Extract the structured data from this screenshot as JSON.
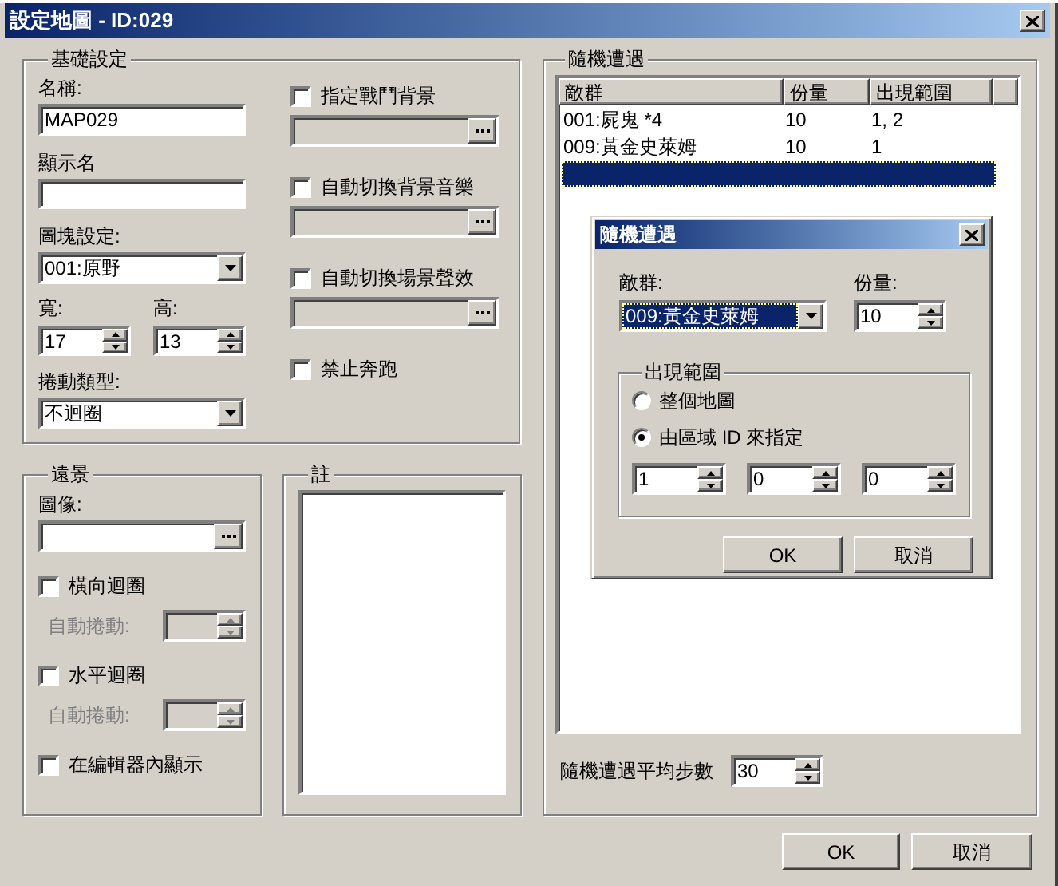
{
  "window": {
    "title": "設定地圖 - ID:029"
  },
  "basic_settings": {
    "title": "基礎設定",
    "name": {
      "label": "名稱:",
      "value": "MAP029"
    },
    "display_name": {
      "label": "顯示名"
    },
    "tileset": {
      "label": "圖塊設定:",
      "value": "001:原野"
    },
    "width": {
      "label": "寬:",
      "value": "17"
    },
    "height": {
      "label": "高:",
      "value": "13"
    },
    "scroll_type": {
      "label": "捲動類型:",
      "value": "不迴圈"
    },
    "options": [
      {
        "kind": "browse",
        "label": "指定戰鬥背景",
        "checked": false
      },
      {
        "kind": "browse",
        "label": "自動切換背景音樂",
        "checked": false
      },
      {
        "kind": "browse",
        "label": "自動切換場景聲效",
        "checked": false
      },
      {
        "kind": "check",
        "label": "禁止奔跑",
        "checked": false
      }
    ]
  },
  "parallax": {
    "title": "遠景",
    "image": {
      "label": "圖像:"
    },
    "items": [
      {
        "kind": "check",
        "label": "橫向迴圈",
        "checked": false
      },
      {
        "kind": "spin",
        "label": "自動捲動:",
        "disabled": true
      },
      {
        "kind": "check",
        "label": "水平迴圈",
        "checked": false
      },
      {
        "kind": "spin",
        "label": "自動捲動:",
        "disabled": true
      },
      {
        "kind": "check",
        "label": "在編輯器內顯示",
        "checked": false
      }
    ]
  },
  "note": {
    "title": "註"
  },
  "encounters": {
    "title": "隨機遭遇",
    "columns": [
      "敵群",
      "份量",
      "出現範圍"
    ],
    "rows": [
      {
        "cells": [
          "001:屍鬼 *4",
          "10",
          "1, 2"
        ],
        "selected": false
      },
      {
        "cells": [
          "009:黃金史萊姆",
          "10",
          "1"
        ],
        "selected": false
      },
      {
        "selected": true
      }
    ],
    "steps": {
      "label": "隨機遭遇平均步數",
      "value": "30"
    }
  },
  "buttons": [
    "OK",
    "取消"
  ],
  "encounter_dialog": {
    "title": "隨機遭遇",
    "troop": {
      "label": "敵群:",
      "value": "009:黃金史萊姆"
    },
    "weight": {
      "label": "份量:",
      "value": "10"
    },
    "range": {
      "title": "出現範圍",
      "options": [
        {
          "label": "整個地圖",
          "selected": false
        },
        {
          "label": "由區域 ID 來指定",
          "selected": true
        }
      ],
      "region_ids": [
        "1",
        "0",
        "0"
      ]
    },
    "buttons": [
      "OK",
      "取消"
    ]
  }
}
